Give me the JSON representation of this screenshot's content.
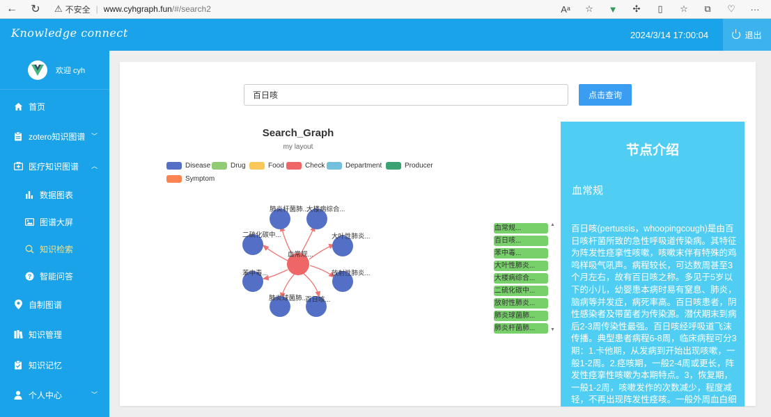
{
  "browser": {
    "security_label": "不安全",
    "url_host": "www.cyhgraph.fun",
    "url_path": "/#/search2"
  },
  "header": {
    "brand": "Knowledge connect",
    "datetime": "2024/3/14 17:00:04",
    "logout_label": "退出"
  },
  "sidebar": {
    "welcome": "欢迎 cyh",
    "items": [
      {
        "label": "首页",
        "icon": "home-icon"
      },
      {
        "label": "zotero知识图谱",
        "icon": "clipboard-icon"
      },
      {
        "label": "医疗知识图谱",
        "icon": "medical-kit-icon"
      },
      {
        "label": "数据图表",
        "icon": "bar-chart-icon"
      },
      {
        "label": "图谱大屏",
        "icon": "picture-icon"
      },
      {
        "label": "知识检索",
        "icon": "search-icon"
      },
      {
        "label": "智能问答",
        "icon": "question-icon"
      },
      {
        "label": "自制图谱",
        "icon": "map-pin-icon"
      },
      {
        "label": "知识管理",
        "icon": "books-icon"
      },
      {
        "label": "知识记忆",
        "icon": "checklist-icon"
      },
      {
        "label": "个人中心",
        "icon": "user-icon"
      }
    ]
  },
  "search": {
    "value": "百日咳",
    "button_label": "点击查询"
  },
  "graph": {
    "title": "Search_Graph",
    "subtitle": "my layout",
    "legend": [
      {
        "label": "Disease",
        "color": "#5470c6"
      },
      {
        "label": "Drug",
        "color": "#91cc75"
      },
      {
        "label": "Food",
        "color": "#fac858"
      },
      {
        "label": "Check",
        "color": "#ee6666"
      },
      {
        "label": "Department",
        "color": "#73c0de"
      },
      {
        "label": "Producer",
        "color": "#3ba272"
      },
      {
        "label": "Symptom",
        "color": "#fc8452"
      }
    ],
    "center_node": {
      "label": "血常规...",
      "category": "Check"
    },
    "nodes": [
      {
        "label": "肺炎杆菌肺...",
        "category": "Disease"
      },
      {
        "label": "大楼病综合...",
        "category": "Disease"
      },
      {
        "label": "大叶性肺炎...",
        "category": "Disease"
      },
      {
        "label": "放射性肺炎...",
        "category": "Disease"
      },
      {
        "label": "百日咳...",
        "category": "Disease"
      },
      {
        "label": "肺炎球菌肺...",
        "category": "Disease"
      },
      {
        "label": "苯中毒...",
        "category": "Disease"
      },
      {
        "label": "二硫化碳中...",
        "category": "Disease"
      }
    ]
  },
  "result_list": [
    "血常规...",
    "百日咳...",
    "苯中毒...",
    "大叶性肺炎...",
    "大楼病综合...",
    "二硫化碳中...",
    "放射性肺炎...",
    "肺炎球菌肺...",
    "肺炎杆菌肺..."
  ],
  "info_panel": {
    "title": "节点介绍",
    "node_name": "血常规",
    "description": "百日咳(pertussis，whoopingcough)是由百日咳杆菌所致的急性呼吸道传染病。其特征为阵发性痉挛性咳嗽，咳嗽末伴有特殊的鸡鸣样吸气吼声。病程较长，可达数周甚至3个月左右，故有百日咳之称。多见于5岁以下的小儿，幼婴患本病时易有窒息、肺炎，脑病等并发症，病死率高。百日咳患者，阴性感染者及带菌者为传染源。潜伏期末到病后2-3周传染性最强。百日咳经呼吸道飞沫传播。典型患者病程6-8周，临床病程可分3期：1.卡他期，从发病到开始出现咳嗽，一般1-2周。2.痉咳期，一般2-4周或更长，阵发性痉挛性咳嗽为本期特点。3，恢复期，一般1-2周，咳嗽发作的次数减少，程度减轻，不再出现阵发性痉咳。一般外周血白细胞计数明显增"
  }
}
